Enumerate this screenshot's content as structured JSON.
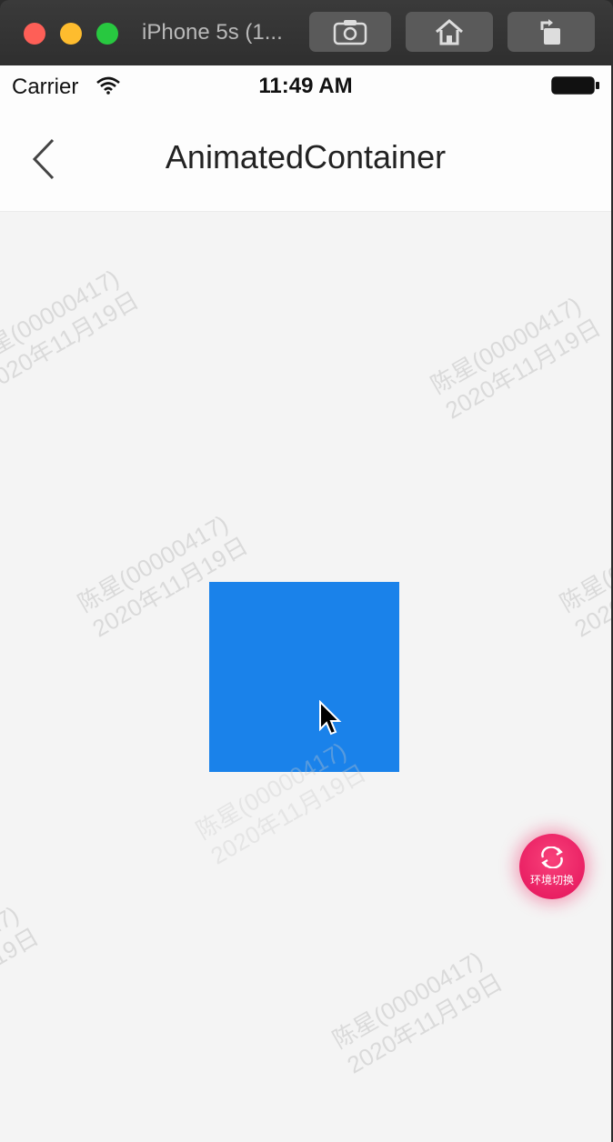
{
  "window": {
    "title": "iPhone 5s (1...",
    "buttons": [
      "screenshot-icon",
      "home-icon",
      "rotate-icon"
    ]
  },
  "status_bar": {
    "carrier": "Carrier",
    "time": "11:49 AM"
  },
  "nav": {
    "title": "AnimatedContainer"
  },
  "fab": {
    "label": "环境切换",
    "color": "#f0206a"
  },
  "box": {
    "color": "#1a82ea"
  },
  "watermark": {
    "line1": "陈星(00000417)",
    "line2": "2020年11月19日"
  }
}
